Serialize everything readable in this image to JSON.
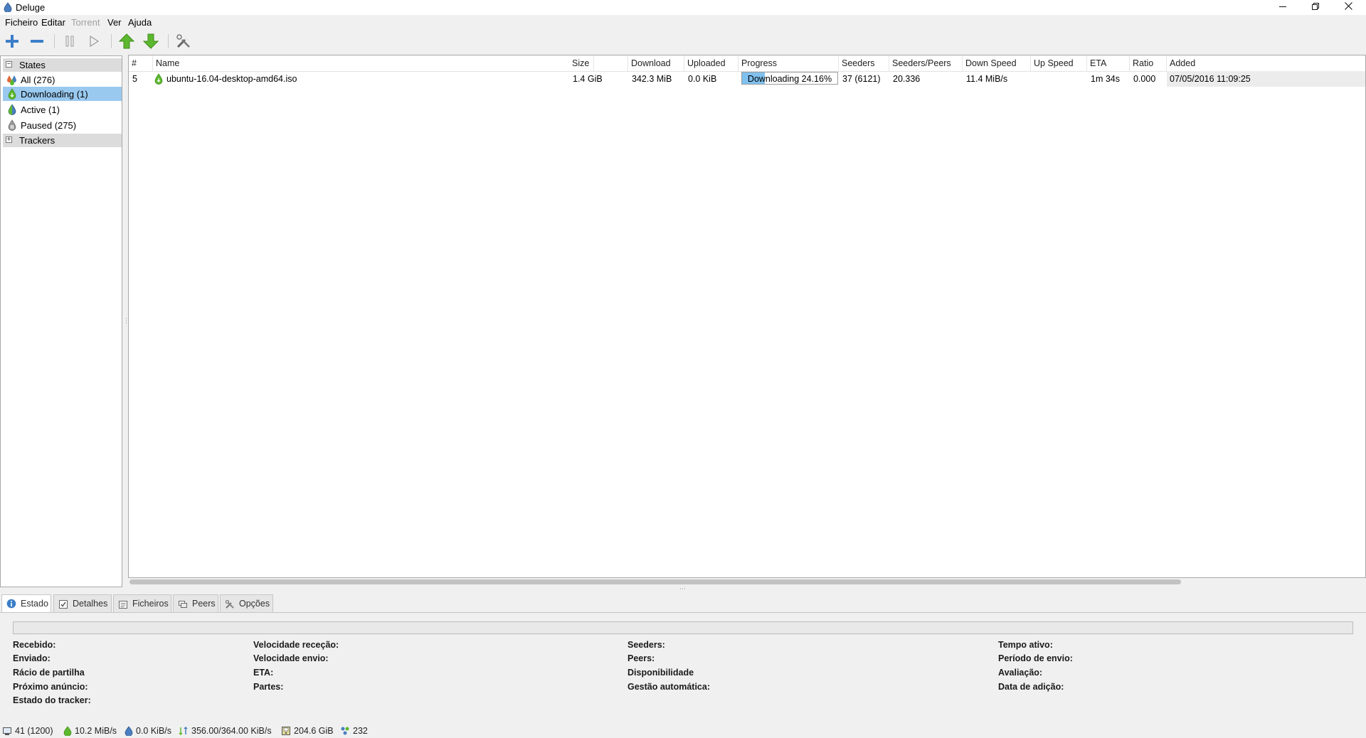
{
  "window": {
    "title": "Deluge"
  },
  "menu": {
    "ficheiro": "Ficheiro",
    "editar": "Editar",
    "torrent": "Torrent",
    "ver": "Ver",
    "ajuda": "Ajuda"
  },
  "sidebar": {
    "states_header": "States",
    "items": [
      {
        "label": "All (276)",
        "icon": "all-icon"
      },
      {
        "label": "Downloading (1)",
        "icon": "downloading-icon",
        "selected": true
      },
      {
        "label": "Active (1)",
        "icon": "active-icon"
      },
      {
        "label": "Paused (275)",
        "icon": "paused-icon"
      }
    ],
    "trackers_header": "Trackers"
  },
  "columns": {
    "num": "#",
    "name": "Name",
    "size": "Size",
    "download": "Download",
    "uploaded": "Uploaded",
    "progress": "Progress",
    "seeders": "Seeders",
    "seeders_peers": "Seeders/Peers",
    "down_speed": "Down Speed",
    "up_speed": "Up Speed",
    "eta": "ETA",
    "ratio": "Ratio",
    "added": "Added"
  },
  "torrents": [
    {
      "num": "5",
      "name": "ubuntu-16.04-desktop-amd64.iso",
      "size": "1.4 GiB",
      "download": "342.3 MiB",
      "uploaded": "0.0 KiB",
      "progress_text": "Downloading 24.16%",
      "progress_fraction": 0.2416,
      "seeders": "37 (6121)",
      "seeders_peers": "20.336",
      "down_speed": "11.4 MiB/s",
      "up_speed": "",
      "eta": "1m 34s",
      "ratio": "0.000",
      "added": "07/05/2016 11:09:25"
    }
  ],
  "tabs": {
    "estado": "Estado",
    "detalhes": "Detalhes",
    "ficheiros": "Ficheiros",
    "peers": "Peers",
    "opcoes": "Opções"
  },
  "details": {
    "recebido": "Recebido:",
    "enviado": "Enviado:",
    "racio": "Rácio de partilha",
    "proximo": "Próximo anúncio:",
    "estado_tracker": "Estado do tracker:",
    "vel_rececao": "Velocidade receção:",
    "vel_envio": "Velocidade envio:",
    "eta": "ETA:",
    "partes": "Partes:",
    "seeders": "Seeders:",
    "peers": "Peers:",
    "disponibilidade": "Disponibilidade",
    "gestao": "Gestão automática:",
    "tempo_ativo": "Tempo ativo:",
    "periodo_envio": "Período de envio:",
    "avaliacao": "Avaliação:",
    "data_adicao": "Data de adição:"
  },
  "status": {
    "connections": "41 (1200)",
    "down_speed": "10.2 MiB/s",
    "up_speed": "0.0 KiB/s",
    "protocol": "356.00/364.00 KiB/s",
    "free_space": "204.6 GiB",
    "dht": "232"
  },
  "colors": {
    "selection": "#99c9ef",
    "progress_fill": "#7fc0ee",
    "arrow_green": "#5cb82e"
  }
}
